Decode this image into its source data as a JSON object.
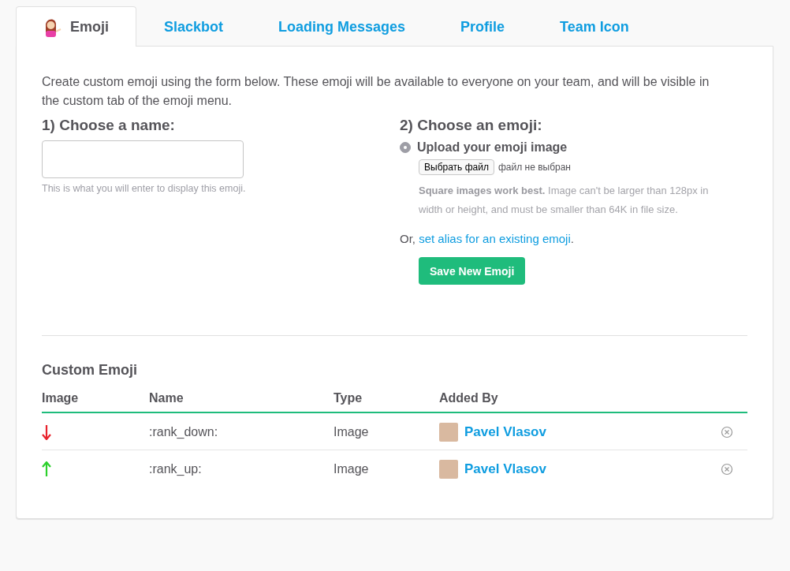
{
  "tabs": [
    {
      "label": "Emoji",
      "selected": true,
      "kind": "emoji"
    },
    {
      "label": "Slackbot",
      "selected": false,
      "kind": "text"
    },
    {
      "label": "Loading Messages",
      "selected": false,
      "kind": "text"
    },
    {
      "label": "Profile",
      "selected": false,
      "kind": "text"
    },
    {
      "label": "Team Icon",
      "selected": false,
      "kind": "text"
    }
  ],
  "intro": "Create custom emoji using the form below. These emoji will be available to everyone on your team, and will be visible in the custom tab of the emoji menu.",
  "name_section": {
    "heading": "1) Choose a name:",
    "hint": "This is what you will enter to display this emoji."
  },
  "emoji_section": {
    "heading": "2) Choose an emoji:",
    "option": {
      "label": "Upload your emoji image",
      "selected": true
    },
    "file_button": "Выбрать файл",
    "file_status": "файл не выбран",
    "note": "**Square images work best.** Image can't be larger than 128px in width or height, and must be smaller than 64K in file size.",
    "alias_prefix": "Or, ",
    "alias_link": "set alias for an existing emoji",
    "alias_suffix": ".",
    "save_button": "Save New Emoji"
  },
  "custom_emoji": {
    "title": "Custom Emoji",
    "columns": [
      "Image",
      "Name",
      "Type",
      "Added By"
    ],
    "rows": [
      {
        "kind": "down",
        "color": "#e8212b",
        "name": ":rank_down:",
        "type": "Image",
        "added_by": "Pavel Vlasov"
      },
      {
        "kind": "up",
        "color": "#2cd02c",
        "name": ":rank_up:",
        "type": "Image",
        "added_by": "Pavel Vlasov"
      }
    ]
  }
}
